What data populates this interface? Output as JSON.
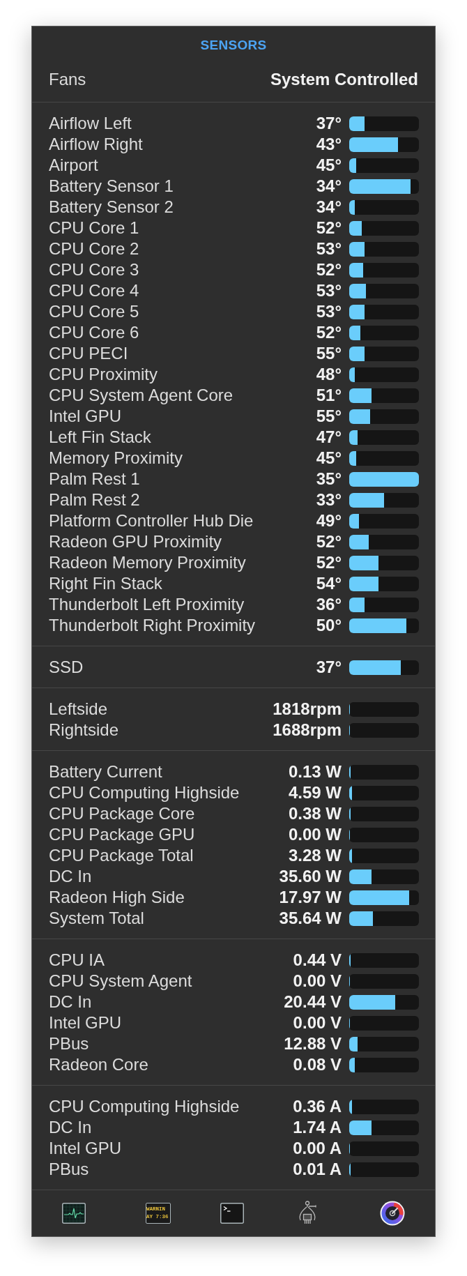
{
  "header": {
    "title": "SENSORS",
    "fan_mode_label": "Fans",
    "fan_mode_value": "System Controlled"
  },
  "sections": [
    {
      "rows": [
        {
          "name": "Airflow Left",
          "value": "37°",
          "level": 0.22
        },
        {
          "name": "Airflow Right",
          "value": "43°",
          "level": 0.7
        },
        {
          "name": "Airport",
          "value": "45°",
          "level": 0.1
        },
        {
          "name": "Battery Sensor 1",
          "value": "34°",
          "level": 0.88
        },
        {
          "name": "Battery Sensor 2",
          "value": "34°",
          "level": 0.08
        },
        {
          "name": "CPU Core 1",
          "value": "52°",
          "level": 0.18
        },
        {
          "name": "CPU Core 2",
          "value": "53°",
          "level": 0.22
        },
        {
          "name": "CPU Core 3",
          "value": "52°",
          "level": 0.2
        },
        {
          "name": "CPU Core 4",
          "value": "53°",
          "level": 0.24
        },
        {
          "name": "CPU Core 5",
          "value": "53°",
          "level": 0.22
        },
        {
          "name": "CPU Core 6",
          "value": "52°",
          "level": 0.16
        },
        {
          "name": "CPU PECI",
          "value": "55°",
          "level": 0.22
        },
        {
          "name": "CPU Proximity",
          "value": "48°",
          "level": 0.08
        },
        {
          "name": "CPU System Agent Core",
          "value": "51°",
          "level": 0.32
        },
        {
          "name": "Intel GPU",
          "value": "55°",
          "level": 0.3
        },
        {
          "name": "Left Fin Stack",
          "value": "47°",
          "level": 0.12
        },
        {
          "name": "Memory Proximity",
          "value": "45°",
          "level": 0.1
        },
        {
          "name": "Palm Rest 1",
          "value": "35°",
          "level": 1
        },
        {
          "name": "Palm Rest 2",
          "value": "33°",
          "level": 0.5
        },
        {
          "name": "Platform Controller Hub Die",
          "value": "49°",
          "level": 0.14
        },
        {
          "name": "Radeon GPU Proximity",
          "value": "52°",
          "level": 0.28
        },
        {
          "name": "Radeon Memory Proximity",
          "value": "52°",
          "level": 0.42
        },
        {
          "name": "Right Fin Stack",
          "value": "54°",
          "level": 0.42
        },
        {
          "name": "Thunderbolt Left Proximity",
          "value": "36°",
          "level": 0.22
        },
        {
          "name": "Thunderbolt Right Proximity",
          "value": "50°",
          "level": 0.82
        }
      ]
    },
    {
      "rows": [
        {
          "name": "SSD",
          "value": "37°",
          "level": 0.74
        }
      ]
    },
    {
      "rows": [
        {
          "name": "Leftside",
          "value": "1818rpm",
          "level": 0
        },
        {
          "name": "Rightside",
          "value": "1688rpm",
          "level": 0
        }
      ]
    },
    {
      "rows": [
        {
          "name": "Battery Current",
          "value": "0.13 W",
          "level": 0.02
        },
        {
          "name": "CPU Computing Highside",
          "value": "4.59 W",
          "level": 0.04
        },
        {
          "name": "CPU Package Core",
          "value": "0.38 W",
          "level": 0.02
        },
        {
          "name": "CPU Package GPU",
          "value": "0.00 W",
          "level": 0
        },
        {
          "name": "CPU Package Total",
          "value": "3.28 W",
          "level": 0.04
        },
        {
          "name": "DC In",
          "value": "35.60 W",
          "level": 0.32
        },
        {
          "name": "Radeon High Side",
          "value": "17.97 W",
          "level": 0.86
        },
        {
          "name": "System Total",
          "value": "35.64 W",
          "level": 0.34
        }
      ]
    },
    {
      "rows": [
        {
          "name": "CPU IA",
          "value": "0.44 V",
          "level": 0.02
        },
        {
          "name": "CPU System Agent",
          "value": "0.00 V",
          "level": 0
        },
        {
          "name": "DC In",
          "value": "20.44 V",
          "level": 0.66
        },
        {
          "name": "Intel GPU",
          "value": "0.00 V",
          "level": 0
        },
        {
          "name": "PBus",
          "value": "12.88 V",
          "level": 0.12
        },
        {
          "name": "Radeon Core",
          "value": "0.08 V",
          "level": 0.08
        }
      ]
    },
    {
      "rows": [
        {
          "name": "CPU Computing Highside",
          "value": "0.36 A",
          "level": 0.04
        },
        {
          "name": "DC In",
          "value": "1.74 A",
          "level": 0.32
        },
        {
          "name": "Intel GPU",
          "value": "0.00 A",
          "level": 0
        },
        {
          "name": "PBus",
          "value": "0.01 A",
          "level": 0.02
        }
      ]
    }
  ],
  "toolbar": [
    {
      "kind": "monitor"
    },
    {
      "kind": "log",
      "lines": [
        "WARNIN",
        "AY 7:36"
      ]
    },
    {
      "kind": "terminal"
    },
    {
      "kind": "caliper"
    },
    {
      "kind": "gauge"
    }
  ]
}
